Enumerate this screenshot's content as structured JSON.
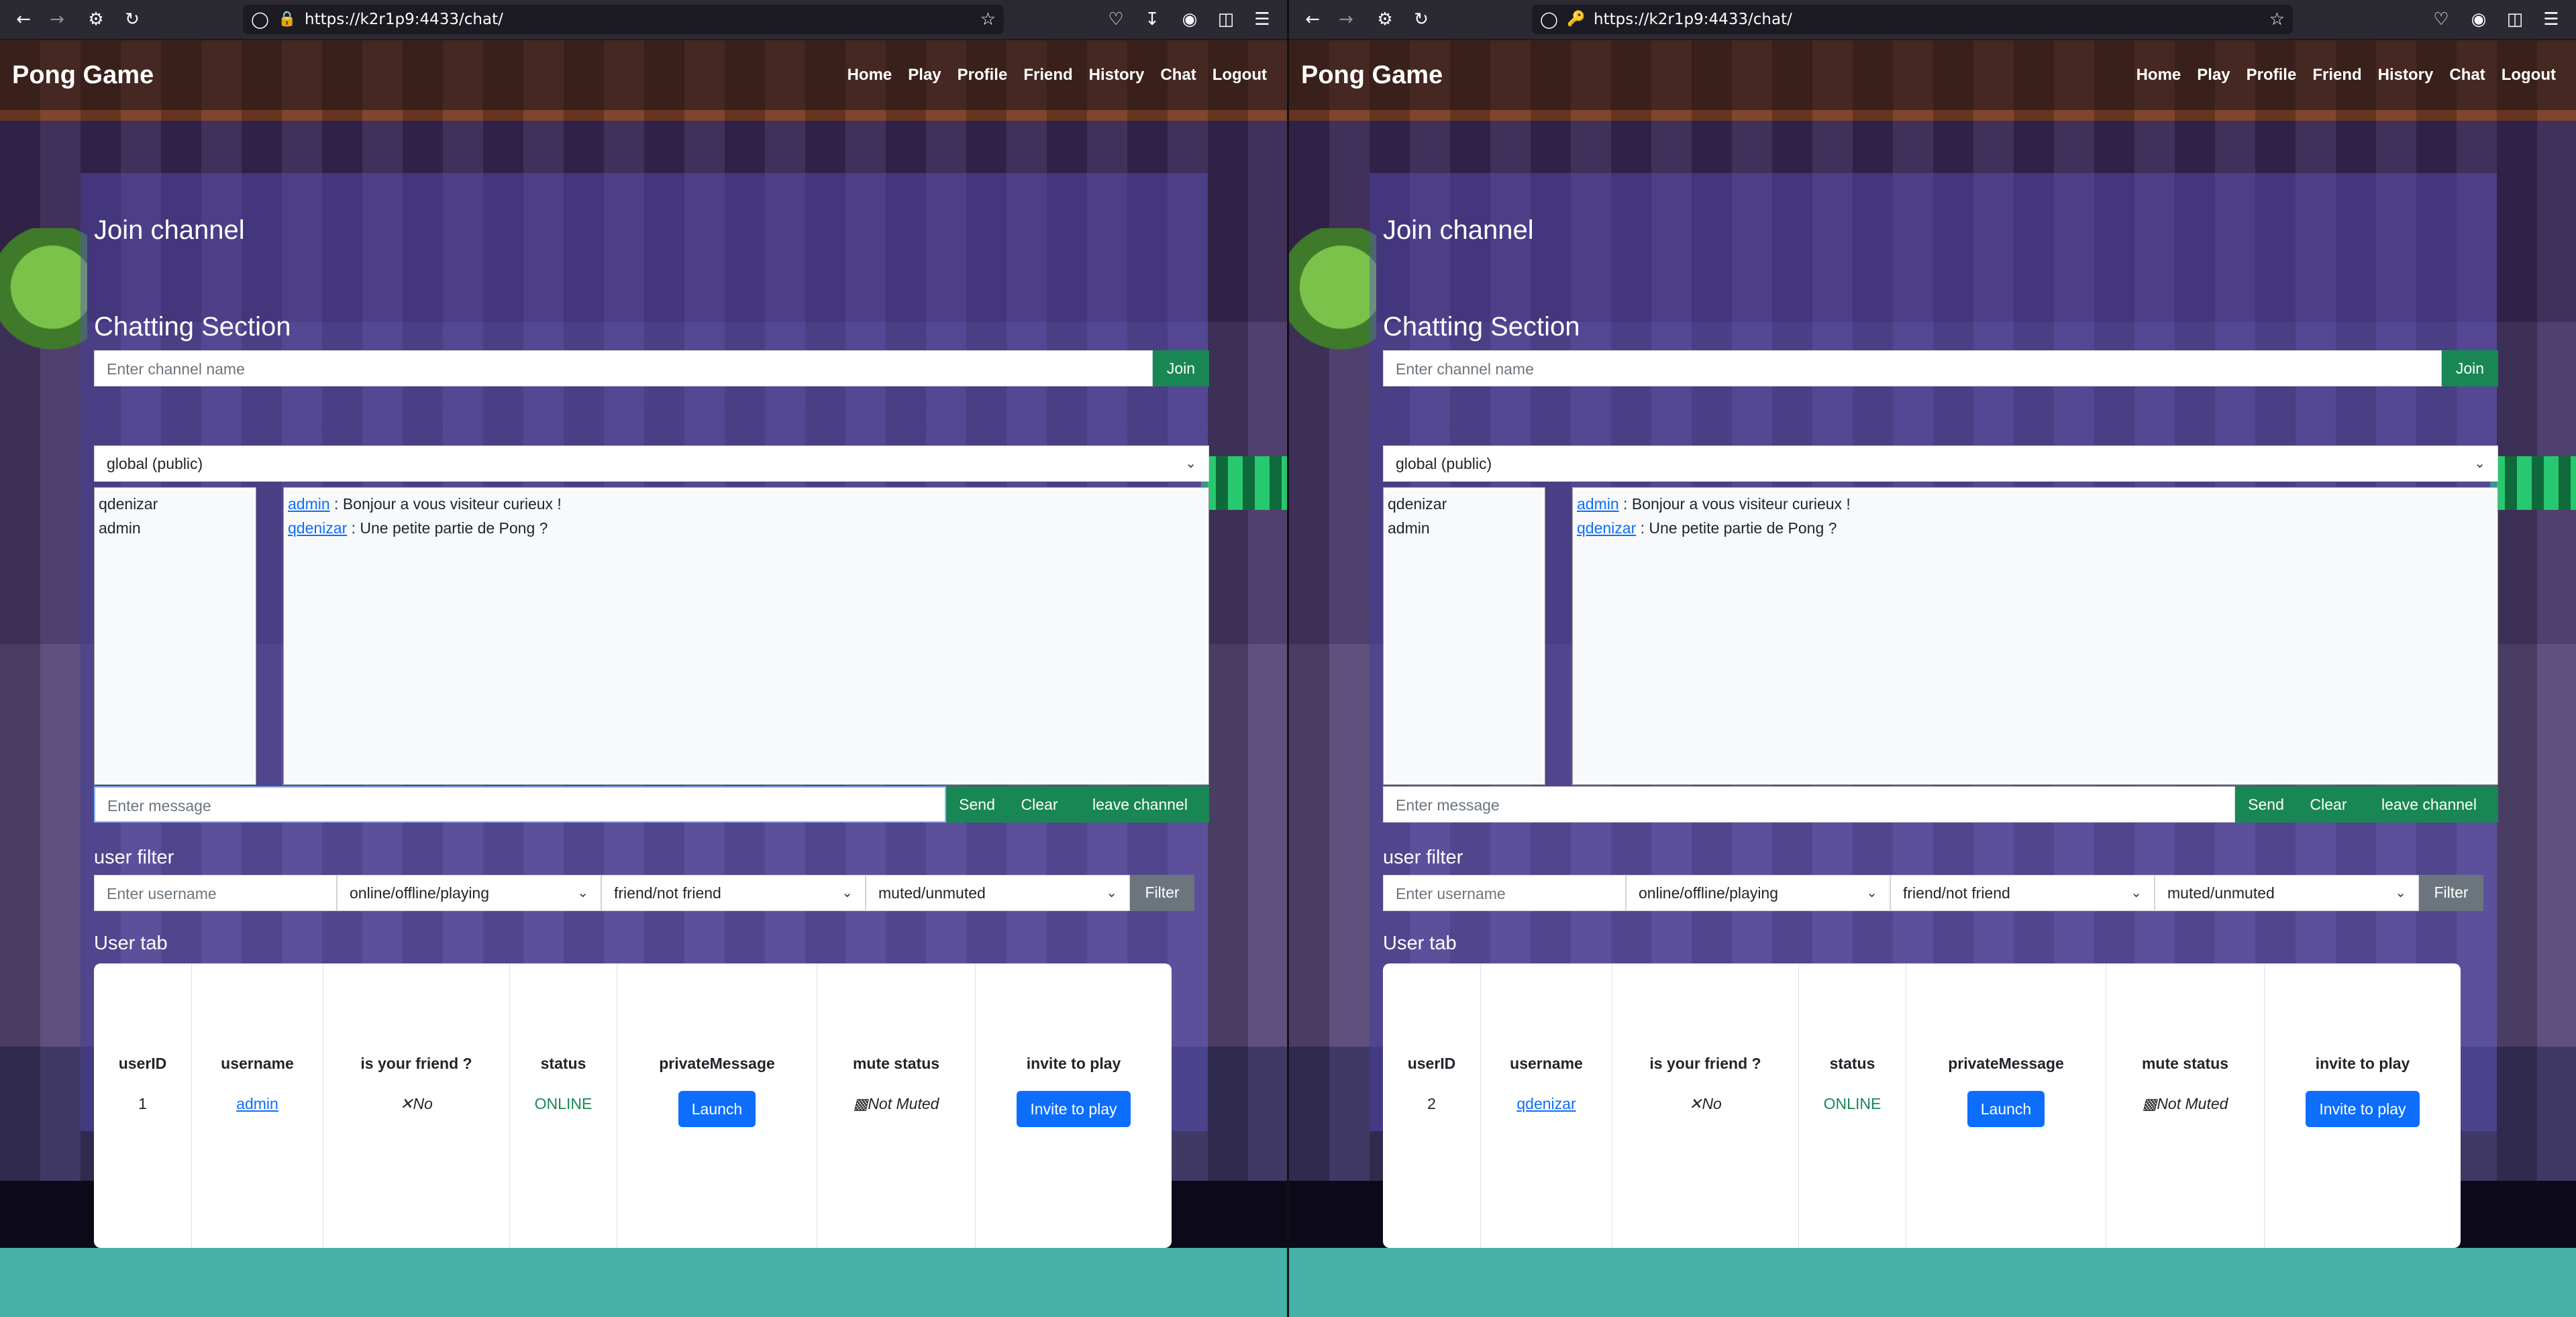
{
  "browser": {
    "url": "https://k2r1p9:4433/chat/"
  },
  "navbar": {
    "brand": "Pong Game",
    "links": [
      "Home",
      "Play",
      "Profile",
      "Friend",
      "History",
      "Chat",
      "Logout"
    ]
  },
  "join": {
    "title": "Join channel",
    "placeholder": "Enter channel name",
    "button": "Join"
  },
  "chatting": {
    "title": "Chatting Section",
    "channel_selected": "global (public)",
    "users": [
      "qdenizar",
      "admin"
    ],
    "messages": [
      {
        "user": "admin",
        "text": " : Bonjour a vous visiteur curieux !"
      },
      {
        "user": "qdenizar",
        "text": " : Une petite partie de Pong ?"
      }
    ],
    "message_placeholder": "Enter message",
    "send_label": "Send",
    "clear_label": "Clear",
    "leave_label": "leave channel"
  },
  "filter": {
    "title": "user filter",
    "username_placeholder": "Enter username",
    "status_option": "online/offline/playing",
    "friend_option": "friend/not friend",
    "mute_option": "muted/unmuted",
    "button": "Filter"
  },
  "user_tab": {
    "title": "User tab",
    "headers": [
      "userID",
      "username",
      "is your friend ?",
      "status",
      "privateMessage",
      "mute status",
      "invite to play"
    ],
    "friend_mark": "No",
    "status_value": "ONLINE",
    "pm_button": "Launch",
    "mute_value": "Not Muted",
    "invite_button": "Invite to play"
  },
  "windows": [
    {
      "row": {
        "userID": "1",
        "username": "admin"
      }
    },
    {
      "row": {
        "userID": "2",
        "username": "qdenizar"
      }
    }
  ],
  "colors": {
    "success": "#198754",
    "primary": "#0d6efd",
    "secondary": "#6c757d"
  }
}
